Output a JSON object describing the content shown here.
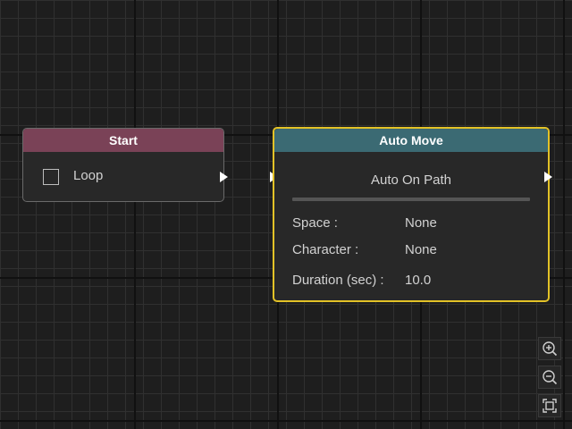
{
  "start_node": {
    "title": "Start",
    "loop_label": "Loop",
    "loop_checked": false,
    "header_color": "#7a4257"
  },
  "auto_move_node": {
    "title": "Auto Move",
    "subtitle": "Auto On Path",
    "header_color": "#3b6a73",
    "selected_border_color": "#e3c227",
    "properties": [
      {
        "label": "Space :",
        "value": "None"
      },
      {
        "label": "Character :",
        "value": "None"
      },
      {
        "label": "Duration (sec) :",
        "value": "10.0"
      }
    ]
  },
  "controls": {
    "zoom_in_icon": "zoom-in-icon",
    "zoom_out_icon": "zoom-out-icon",
    "fit_view_icon": "fit-view-icon"
  }
}
